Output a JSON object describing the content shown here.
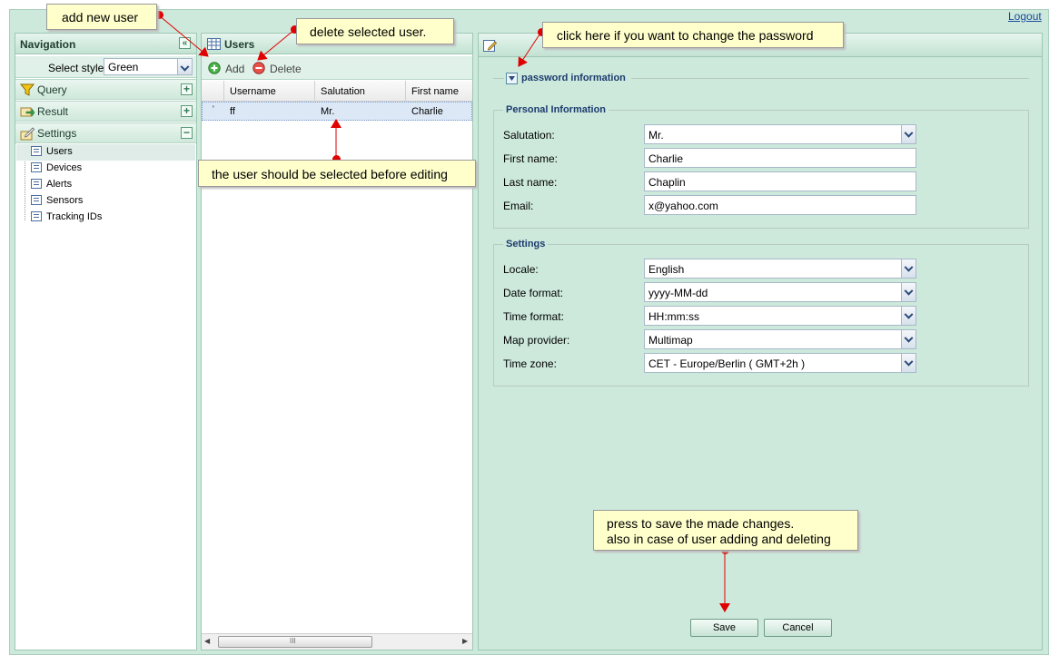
{
  "header": {
    "logout_label": "Logout"
  },
  "navigation": {
    "title": "Navigation",
    "select_style_label": "Select style",
    "select_style_value": "Green",
    "sections": [
      {
        "label": "Query",
        "icon": "funnel-icon",
        "state": "collapsed"
      },
      {
        "label": "Result",
        "icon": "result-arrow-icon",
        "state": "collapsed"
      },
      {
        "label": "Settings",
        "icon": "settings-pencil-icon",
        "state": "expanded"
      }
    ],
    "settings_items": [
      "Users",
      "Devices",
      "Alerts",
      "Sensors",
      "Tracking IDs"
    ],
    "selected_item": "Users"
  },
  "users_panel": {
    "title": "Users",
    "add_label": "Add",
    "delete_label": "Delete",
    "columns": [
      "Username",
      "Salutation",
      "First name"
    ],
    "rows": [
      {
        "username": "ff",
        "salutation": "Mr.",
        "first_name": "Charlie"
      }
    ],
    "scroll_marker": "III"
  },
  "detail_panel": {
    "password_toggle_label": "password information",
    "personal_info": {
      "legend": "Personal Information",
      "salutation_label": "Salutation:",
      "salutation_value": "Mr.",
      "first_name_label": "First name:",
      "first_name_value": "Charlie",
      "last_name_label": "Last name:",
      "last_name_value": "Chaplin",
      "email_label": "Email:",
      "email_value": "x@yahoo.com"
    },
    "settings": {
      "legend": "Settings",
      "locale_label": "Locale:",
      "locale_value": "English",
      "date_format_label": "Date format:",
      "date_format_value": "yyyy-MM-dd",
      "time_format_label": "Time format:",
      "time_format_value": "HH:mm:ss",
      "map_provider_label": "Map provider:",
      "map_provider_value": "Multimap",
      "time_zone_label": "Time zone:",
      "time_zone_value": "CET - Europe/Berlin ( GMT+2h )"
    },
    "save_label": "Save",
    "cancel_label": "Cancel"
  },
  "callouts": {
    "add_new_user": "add new user",
    "delete_selected": "delete selected user.",
    "change_password": "click here if you want to change the password",
    "select_before_edit": "the user should be selected before editing",
    "save_line1": "press to save the made changes.",
    "save_line2": "also in case of user adding and deleting"
  },
  "colors": {
    "frame_bg": "#cde9dc",
    "callout_bg": "#ffffcc",
    "pointer_red": "#e00000",
    "link_blue": "#1a4a9a"
  }
}
